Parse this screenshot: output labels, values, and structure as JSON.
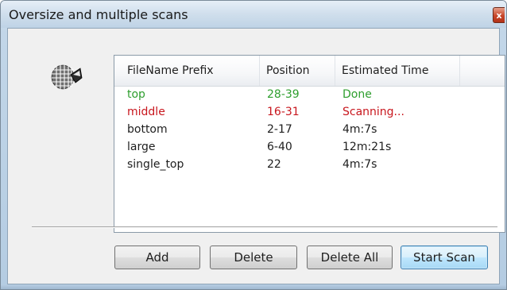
{
  "window": {
    "title": "Oversize and multiple scans",
    "close_glyph": "x"
  },
  "icon": "scanner-grid-icon",
  "table": {
    "columns": [
      "FileName Prefix",
      "Position",
      "Estimated Time"
    ],
    "rows": [
      {
        "prefix": "top",
        "position": "28-39",
        "time": "Done",
        "color": "#2e9e2e"
      },
      {
        "prefix": "middle",
        "position": "16-31",
        "time": "Scanning...",
        "color": "#c8161d"
      },
      {
        "prefix": "bottom",
        "position": "2-17",
        "time": "4m:7s",
        "color": "#1e1e1e"
      },
      {
        "prefix": "large",
        "position": "6-40",
        "time": "12m:21s",
        "color": "#1e1e1e"
      },
      {
        "prefix": "single_top",
        "position": "22",
        "time": "4m:7s",
        "color": "#1e1e1e"
      }
    ]
  },
  "buttons": {
    "add": "Add",
    "delete": "Delete",
    "delete_all": "Delete All",
    "start_scan": "Start Scan"
  },
  "colors": {
    "done": "#2e9e2e",
    "scanning": "#c8161d",
    "default_button_border": "#3c7fb1"
  }
}
